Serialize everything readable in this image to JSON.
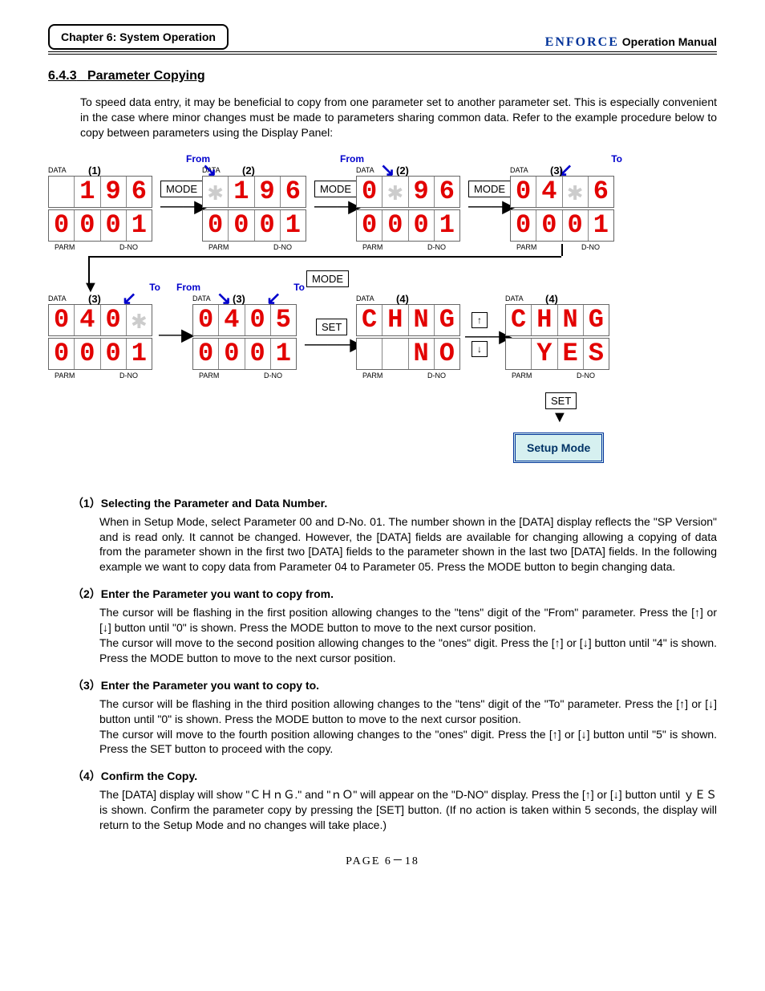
{
  "header": {
    "chapter": "Chapter 6: System Operation",
    "brand": "enFORCE",
    "manual": "Operation Manual"
  },
  "section": {
    "number": "6.4.3",
    "title": "Parameter Copying",
    "intro": "To speed data entry, it may be beneficial to copy from one parameter set to another parameter set. This is especially convenient in the case where minor changes must be made to parameters sharing common data. Refer to the example procedure below to copy between parameters using the Display Panel:"
  },
  "labels": {
    "data": "DATA",
    "parm": "PARM",
    "dno": "D-NO",
    "mode": "MODE",
    "set": "SET",
    "from": "From",
    "to": "To",
    "up": "↑",
    "down": "↓",
    "setup_mode": "Setup Mode"
  },
  "panels": {
    "p1": {
      "step": "(1)",
      "top": [
        "",
        "1",
        "9",
        "6"
      ],
      "bot": [
        "0",
        "0",
        "0",
        "1"
      ]
    },
    "p2a": {
      "step": "(2)",
      "top": [
        "*",
        "1",
        "9",
        "6"
      ],
      "bot": [
        "0",
        "0",
        "0",
        "1"
      ]
    },
    "p2b": {
      "step": "(2)",
      "top": [
        "0",
        "*",
        "9",
        "6"
      ],
      "bot": [
        "0",
        "0",
        "0",
        "1"
      ]
    },
    "p3a": {
      "step": "(3)",
      "top": [
        "0",
        "4",
        "*",
        "6"
      ],
      "bot": [
        "0",
        "0",
        "0",
        "1"
      ]
    },
    "p3b": {
      "step": "(3)",
      "top": [
        "0",
        "4",
        "0",
        "*"
      ],
      "bot": [
        "0",
        "0",
        "0",
        "1"
      ]
    },
    "p3c": {
      "step": "(3)",
      "top": [
        "0",
        "4",
        "0",
        "5"
      ],
      "bot": [
        "0",
        "0",
        "0",
        "1"
      ]
    },
    "p4a": {
      "step": "(4)",
      "top": [
        "C",
        "H",
        "N",
        "G"
      ],
      "bot": [
        "",
        "",
        "N",
        "O"
      ]
    },
    "p4b": {
      "step": "(4)",
      "top": [
        "C",
        "H",
        "N",
        "G"
      ],
      "bot": [
        "",
        "Y",
        "E",
        "S"
      ]
    }
  },
  "steps": {
    "s1": {
      "num": "（1）",
      "title": "Selecting the Parameter and Data Number.",
      "body": "When in Setup Mode, select Parameter 00 and D-No. 01. The number shown in the [DATA] display reflects the \"SP Version\" and is read only. It cannot be changed. However, the [DATA] fields are available for changing allowing a copying of data from the parameter shown in the first two [DATA] fields to the parameter shown in the last two [DATA] fields. In the following example we want to copy data from Parameter 04 to Parameter 05. Press the MODE button to begin changing data."
    },
    "s2": {
      "num": "（2）",
      "title": "Enter the Parameter you want to copy from.",
      "body": "The cursor will be flashing in the first position allowing changes to the \"tens\" digit of the \"From\" parameter. Press the [↑] or [↓] button until \"0\" is shown. Press the MODE button to move to the next cursor position.\nThe cursor will move to the second position allowing changes to the \"ones\" digit. Press the [↑] or [↓] button until \"4\" is shown. Press the MODE button to move to the next cursor position."
    },
    "s3": {
      "num": "（3）",
      "title": "Enter the Parameter you want to copy to.",
      "body": "The cursor will be flashing in the third position allowing changes to the \"tens\" digit of the \"To\" parameter. Press the [↑] or [↓] button until \"0\" is shown. Press the MODE button to move to the next cursor position.\nThe cursor will move to the fourth position allowing changes to the \"ones\" digit. Press the [↑] or [↓] button until \"5\" is shown. Press the SET button to proceed with the copy."
    },
    "s4": {
      "num": "（4）",
      "title": "Confirm the Copy.",
      "body": "The [DATA] display will show \"ＣＨｎＧ.\" and \"ｎＯ\" will appear on the \"D-NO\" display. Press the [↑] or [↓] button until ｙＥＳ is shown. Confirm the parameter copy by pressing the [SET] button. (If no action is taken within 5 seconds, the display will return to the Setup Mode and no changes will take place.)"
    }
  },
  "footer": {
    "page": "PAGE 6－18"
  }
}
